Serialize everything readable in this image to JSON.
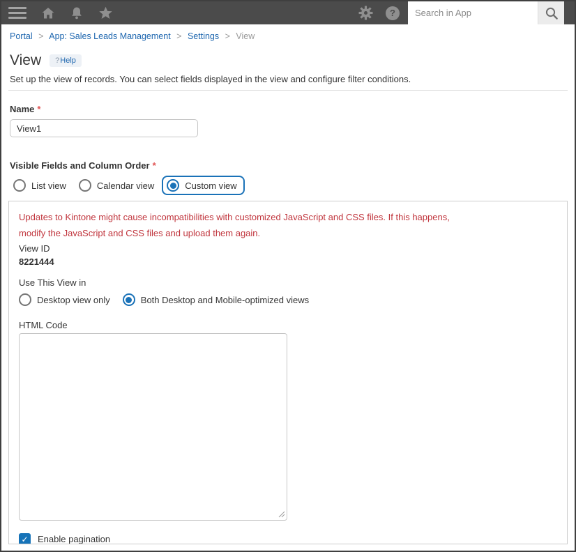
{
  "header": {
    "search_placeholder": "Search in App"
  },
  "breadcrumb": {
    "separator": ">",
    "items": [
      {
        "label": "Portal"
      },
      {
        "label": "App: Sales Leads Management"
      },
      {
        "label": "Settings"
      },
      {
        "label": "View"
      }
    ]
  },
  "page": {
    "title": "View",
    "help_q": "?",
    "help_label": "Help",
    "description": "Set up the view of records. You can select fields displayed in the view and configure filter conditions."
  },
  "name_field": {
    "label": "Name",
    "required_mark": "*",
    "value": "View1"
  },
  "view_type": {
    "label": "Visible Fields and Column Order",
    "required_mark": "*",
    "options": [
      {
        "label": "List view",
        "selected": false
      },
      {
        "label": "Calendar view",
        "selected": false
      },
      {
        "label": "Custom view",
        "selected": true
      }
    ]
  },
  "custom_view_panel": {
    "warning_lines": [
      "Updates to Kintone might cause incompatibilities with customized JavaScript and CSS files. If this happens,",
      "modify the JavaScript and CSS files and upload them again."
    ],
    "view_id_label": "View ID",
    "view_id_value": "8221444",
    "use_view_label": "Use This View in",
    "use_view_options": [
      {
        "label": "Desktop view only",
        "selected": false
      },
      {
        "label": "Both Desktop and Mobile-optimized views",
        "selected": true
      }
    ],
    "html_code_label": "HTML Code",
    "html_code_value": "",
    "pagination": {
      "label": "Enable pagination",
      "checked": true
    }
  },
  "colors": {
    "accent_blue": "#1a72b8",
    "link_blue": "#2068b0",
    "warning_red": "#c0343c",
    "required_red": "#e05252",
    "topbar_gray": "#4b4b4b"
  }
}
